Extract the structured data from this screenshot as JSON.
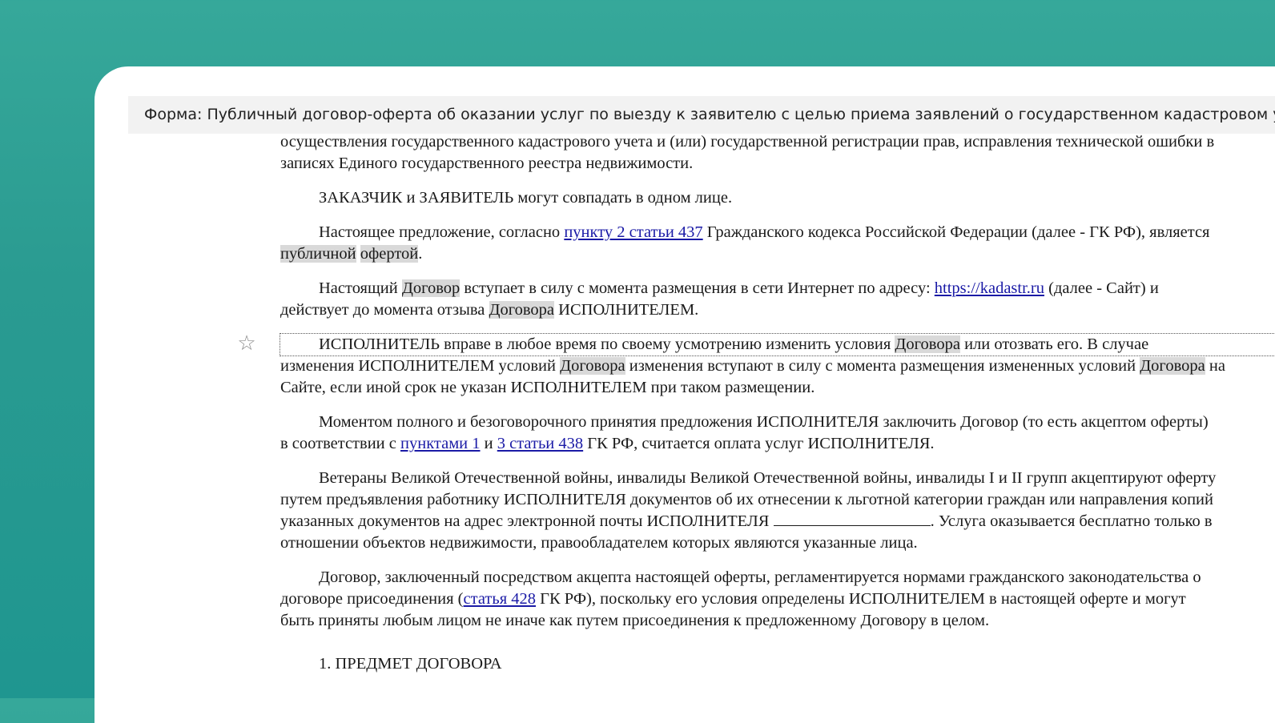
{
  "window": {
    "title": "Форма: Публичный договор-оферта об оказании услуг по выезду к заявителю с целью приема заявлений о государственном кадастровом учете"
  },
  "icons": {
    "bookmark": "star-outline-icon"
  },
  "document": {
    "p0": {
      "l1": "осуществления государственного кадастрового учета и (или) государственной регистрации прав, исправления технической ошибки в",
      "l2": "записях Единого государственного реестра недвижимости."
    },
    "p1": {
      "l1": "ЗАКАЗЧИК и ЗАЯВИТЕЛЬ могут совпадать в одном лице."
    },
    "p2": {
      "a": "Настоящее предложение, согласно ",
      "link": "пункту 2 статьи 437",
      "b": " Гражданского кодекса Российской Федерации (далее - ГК РФ), является",
      "hl1": "публичной",
      "sp": " ",
      "hl2": "офертой",
      "end": "."
    },
    "p3": {
      "a": "Настоящий ",
      "hl1": "Договор",
      "b": " вступает в силу с момента размещения в сети Интернет по адресу: ",
      "link": "https://kadastr.ru",
      "c": " (далее - Сайт) и",
      "d": "действует до момента отзыва ",
      "hl2": "Договора",
      "e": " ИСПОЛНИТЕЛЕМ."
    },
    "p4": {
      "a": "ИСПОЛНИТЕЛЬ вправе в любое время по своему усмотрению изменить условия ",
      "hl1": "Договора",
      "b": " или отозвать его. В случае",
      "c": "изменения ИСПОЛНИТЕЛЕМ условий ",
      "hl2": "Договора",
      "d": " изменения вступают в силу с момента размещения измененных условий ",
      "hl3": "Договора",
      "e": " на",
      "f": "Сайте, если иной срок не указан ИСПОЛНИТЕЛЕМ при таком размещении."
    },
    "p5": {
      "a": "Моментом полного и безоговорочного принятия предложения ИСПОЛНИТЕЛЯ заключить Договор (то есть акцептом оферты)",
      "b": "в соответствии с ",
      "link1": "пунктами 1",
      "c": " и ",
      "link2": "3 статьи 438",
      "d": " ГК РФ, считается оплата услуг ИСПОЛНИТЕЛЯ."
    },
    "p6": {
      "l1": "Ветераны Великой Отечественной войны, инвалиды Великой Отечественной войны, инвалиды I и II групп акцептируют оферту",
      "l2": "путем предъявления работнику ИСПОЛНИТЕЛЯ документов об их отнесении к льготной категории граждан или направления копий",
      "l3a": "указанных документов на адрес электронной почты ИСПОЛНИТЕЛЯ ",
      "l3b": ". Услуга оказывается бесплатно только в",
      "l4": "отношении объектов недвижимости, правообладателем которых являются указанные лица."
    },
    "p7": {
      "l1": "Договор, заключенный посредством акцепта настоящей оферты, регламентируется нормами гражданского законодательства о",
      "l2a": "договоре присоединения (",
      "link": "статья 428",
      "l2b": " ГК РФ), поскольку его условия определены ИСПОЛНИТЕЛЕМ в настоящей оферте и могут",
      "l3": "быть приняты любым лицом не иначе как путем присоединения к предложенному Договору в целом."
    },
    "section1": "1. ПРЕДМЕТ ДОГОВОРА"
  }
}
